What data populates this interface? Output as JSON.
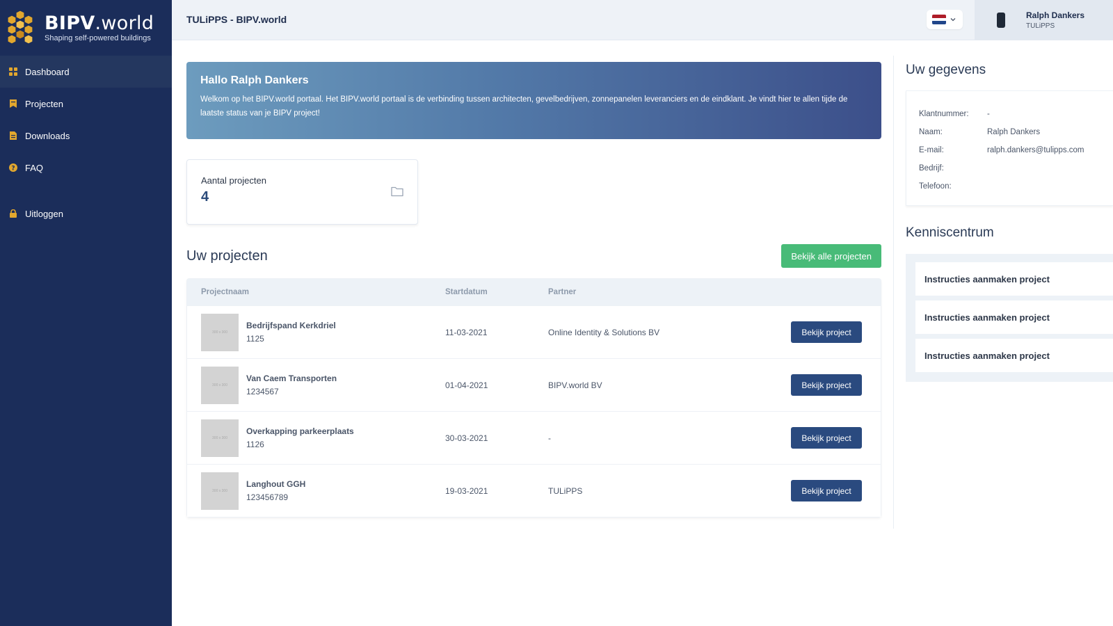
{
  "brand": {
    "name_bold": "BIPV",
    "name_light": ".world",
    "tagline": "Shaping self-powered buildings"
  },
  "sidebar": {
    "items": [
      {
        "label": "Dashboard",
        "icon": "grid-icon",
        "active": true
      },
      {
        "label": "Projecten",
        "icon": "bookmark-icon"
      },
      {
        "label": "Downloads",
        "icon": "file-icon"
      },
      {
        "label": "FAQ",
        "icon": "question-icon"
      }
    ],
    "logout_label": "Uitloggen"
  },
  "header": {
    "title": "TULiPPS - BIPV.world",
    "language": "nl-flag-icon",
    "user_name": "Ralph Dankers",
    "user_company": "TULiPPS"
  },
  "hero": {
    "title": "Hallo Ralph Dankers",
    "text": "Welkom op het BIPV.world portaal. Het BIPV.world portaal is de verbinding tussen architecten, gevelbedrijven, zonnepanelen leveranciers en de eindklant. Je vindt hier te allen tijde de laatste status van je BIPV project!"
  },
  "stats": {
    "label": "Aantal projecten",
    "value": "4"
  },
  "projects": {
    "title": "Uw projecten",
    "view_all_label": "Bekijk alle projecten",
    "columns": [
      "Projectnaam",
      "Startdatum",
      "Partner"
    ],
    "button_label": "Bekijk project",
    "thumb_label": "300 x 300",
    "rows": [
      {
        "name": "Bedrijfspand Kerkdriel",
        "number": "1125",
        "start": "11-03-2021",
        "partner": "Online Identity & Solutions BV"
      },
      {
        "name": "Van Caem Transporten",
        "number": "1234567",
        "start": "01-04-2021",
        "partner": "BIPV.world BV"
      },
      {
        "name": "Overkapping parkeerplaats",
        "number": "1126",
        "start": "30-03-2021",
        "partner": "-"
      },
      {
        "name": "Langhout GGH",
        "number": "123456789",
        "start": "19-03-2021",
        "partner": "TULiPPS"
      }
    ]
  },
  "details": {
    "title": "Uw gegevens",
    "fields": [
      {
        "key": "Klantnummer:",
        "value": "-"
      },
      {
        "key": "Naam:",
        "value": "Ralph Dankers"
      },
      {
        "key": "E-mail:",
        "value": "ralph.dankers@tulipps.com"
      },
      {
        "key": "Bedrijf:",
        "value": ""
      },
      {
        "key": "Telefoon:",
        "value": ""
      }
    ]
  },
  "knowledge": {
    "title": "Kenniscentrum",
    "items": [
      "Instructies aanmaken project",
      "Instructies aanmaken project",
      "Instructies aanmaken project"
    ]
  },
  "colors": {
    "sidebar": "#1b2d5a",
    "accent_green": "#48bb78",
    "button_blue": "#2a4a7f",
    "icon_gold": "#e2a72e"
  }
}
